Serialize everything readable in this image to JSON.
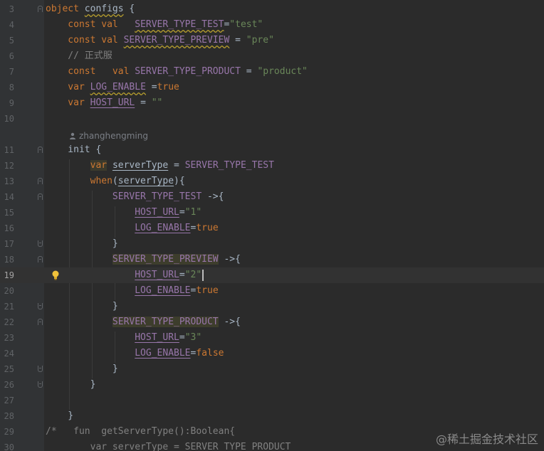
{
  "author": "zhanghengming",
  "watermark": "@稀土掘金技术社区",
  "lines": [
    {
      "n": "3",
      "t": [
        [
          "kw",
          "object "
        ],
        [
          "plain wavy",
          "configs"
        ],
        [
          "plain",
          " {"
        ]
      ]
    },
    {
      "n": "4",
      "t": [
        [
          "kw",
          "    const val   "
        ],
        [
          "prop wavy",
          "SERVER_TYPE_TEST"
        ],
        [
          "plain",
          "="
        ],
        [
          "str",
          "\"test\""
        ]
      ]
    },
    {
      "n": "5",
      "t": [
        [
          "kw",
          "    const val "
        ],
        [
          "prop wavy",
          "SERVER_TYPE_PREVIEW"
        ],
        [
          "plain",
          " = "
        ],
        [
          "str",
          "\"pre\""
        ]
      ]
    },
    {
      "n": "6",
      "t": [
        [
          "cmt",
          "    // 正式服"
        ]
      ]
    },
    {
      "n": "7",
      "t": [
        [
          "kw",
          "    const   val "
        ],
        [
          "prop",
          "SERVER_TYPE_PRODUCT"
        ],
        [
          "plain",
          " = "
        ],
        [
          "str",
          "\"product\""
        ]
      ]
    },
    {
      "n": "8",
      "t": [
        [
          "kw",
          "    var "
        ],
        [
          "prop wavy",
          "LOG_ENABLE"
        ],
        [
          "plain",
          " ="
        ],
        [
          "kw",
          "true"
        ]
      ]
    },
    {
      "n": "9",
      "t": [
        [
          "kw",
          "    var "
        ],
        [
          "prop ul",
          "HOST_URL"
        ],
        [
          "plain",
          " = "
        ],
        [
          "str",
          "\"\""
        ]
      ]
    },
    {
      "n": "10",
      "t": []
    },
    {
      "n": "11",
      "t": [
        [
          "plain",
          "    init {"
        ]
      ]
    },
    {
      "n": "12",
      "t": [
        [
          "plain",
          "        "
        ],
        [
          "kw hl",
          "var"
        ],
        [
          "plain",
          " "
        ],
        [
          "plain ul",
          "serverType"
        ],
        [
          "plain",
          " = "
        ],
        [
          "prop",
          "SERVER_TYPE_TEST"
        ]
      ]
    },
    {
      "n": "13",
      "t": [
        [
          "kw",
          "        when"
        ],
        [
          "plain",
          "("
        ],
        [
          "plain ul",
          "serverType"
        ],
        [
          "plain",
          "){"
        ]
      ]
    },
    {
      "n": "14",
      "t": [
        [
          "prop",
          "            SERVER_TYPE_TEST"
        ],
        [
          "plain",
          " ->{"
        ]
      ]
    },
    {
      "n": "15",
      "t": [
        [
          "plain",
          "                "
        ],
        [
          "prop ul",
          "HOST_URL"
        ],
        [
          "plain",
          "="
        ],
        [
          "str",
          "\"1\""
        ]
      ]
    },
    {
      "n": "16",
      "t": [
        [
          "plain",
          "                "
        ],
        [
          "prop ul",
          "LOG_ENABLE"
        ],
        [
          "plain",
          "="
        ],
        [
          "kw",
          "true"
        ]
      ]
    },
    {
      "n": "17",
      "t": [
        [
          "plain",
          "            }"
        ]
      ]
    },
    {
      "n": "18",
      "t": [
        [
          "plain",
          "            "
        ],
        [
          "prop hl2",
          "SERVER_TYPE_PREVIEW"
        ],
        [
          "plain",
          " ->{"
        ]
      ]
    },
    {
      "n": "19",
      "t": [
        [
          "plain",
          "                "
        ],
        [
          "prop ul",
          "HOST_URL"
        ],
        [
          "plain",
          "="
        ],
        [
          "str",
          "\"2\""
        ]
      ],
      "current": true,
      "cursor": true
    },
    {
      "n": "20",
      "t": [
        [
          "plain",
          "                "
        ],
        [
          "prop ul",
          "LOG_ENABLE"
        ],
        [
          "plain",
          "="
        ],
        [
          "kw",
          "true"
        ]
      ]
    },
    {
      "n": "21",
      "t": [
        [
          "plain",
          "            }"
        ]
      ]
    },
    {
      "n": "22",
      "t": [
        [
          "plain",
          "            "
        ],
        [
          "prop hl2",
          "SERVER_TYPE_PRODUCT"
        ],
        [
          "plain",
          " ->{"
        ]
      ]
    },
    {
      "n": "23",
      "t": [
        [
          "plain",
          "                "
        ],
        [
          "prop ul",
          "HOST_URL"
        ],
        [
          "plain",
          "="
        ],
        [
          "str",
          "\"3\""
        ]
      ]
    },
    {
      "n": "24",
      "t": [
        [
          "plain",
          "                "
        ],
        [
          "prop ul",
          "LOG_ENABLE"
        ],
        [
          "plain",
          "="
        ],
        [
          "kw",
          "false"
        ]
      ]
    },
    {
      "n": "25",
      "t": [
        [
          "plain",
          "            }"
        ]
      ]
    },
    {
      "n": "26",
      "t": [
        [
          "plain",
          "        }"
        ]
      ]
    },
    {
      "n": "27",
      "t": []
    },
    {
      "n": "28",
      "t": [
        [
          "plain",
          "    }"
        ]
      ]
    },
    {
      "n": "29",
      "t": [
        [
          "cmt",
          "/*   fun  getServerType():Boolean{"
        ]
      ]
    },
    {
      "n": "30",
      "t": [
        [
          "cmt",
          "        var serverType = SERVER_TYPE_PRODUCT"
        ]
      ]
    }
  ]
}
